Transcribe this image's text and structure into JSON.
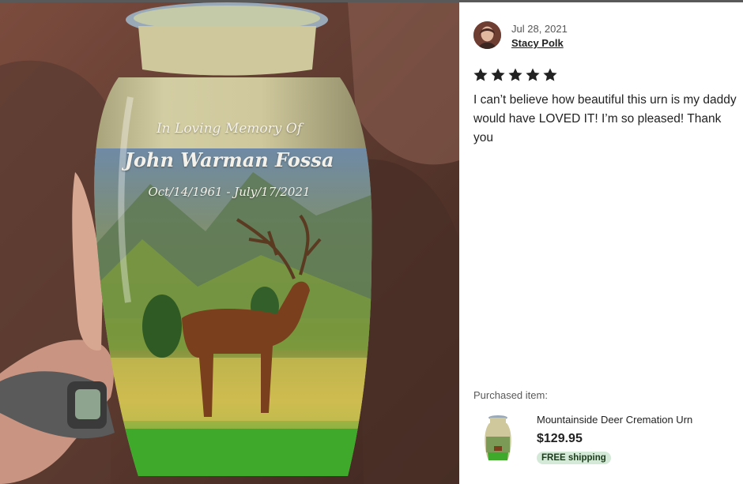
{
  "photo": {
    "alt_icon": "urn-photo",
    "engraving": {
      "line1": "In Loving Memory Of",
      "line2": "John Warman Fossa",
      "line3": "Oct/14/1961 - July/17/2021"
    }
  },
  "review": {
    "date": "Jul 28, 2021",
    "reviewer": "Stacy Polk",
    "rating": 5,
    "text": "I can’t believe how beautiful this urn is my daddy would have LOVED IT! I’m so pleased! Thank you"
  },
  "purchased": {
    "label": "Purchased item:",
    "title": "Mountainside Deer Cremation Urn",
    "price": "$129.95",
    "shipping": "FREE shipping"
  },
  "colors": {
    "star": "#222222",
    "shipping_badge": "#d4e9d7",
    "shipping_text": "#1b3b1b"
  }
}
